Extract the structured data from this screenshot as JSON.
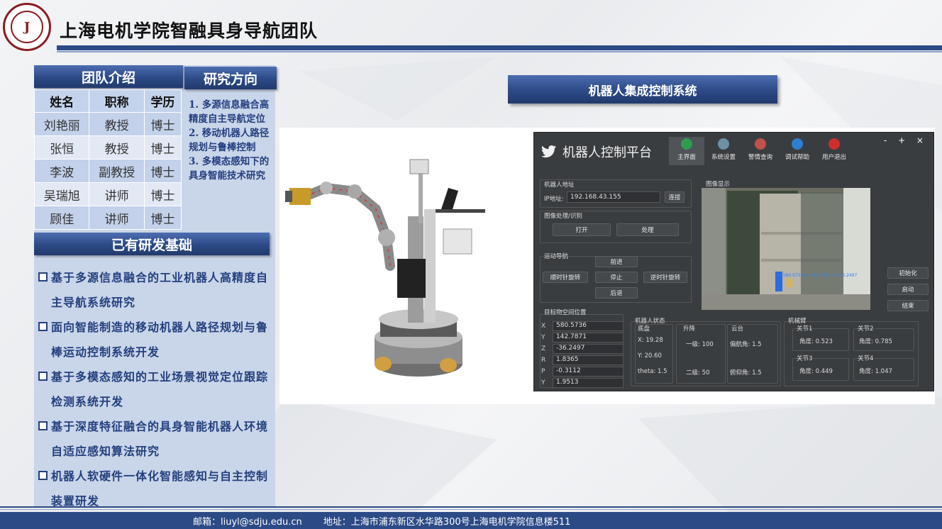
{
  "header": {
    "title": "上海电机学院智融具身导航团队",
    "logo_text": "上海电机学院",
    "logo_ring": "SHANGHAI DIANJI UNIVERSITY"
  },
  "team": {
    "heading": "团队介绍",
    "columns": [
      "姓名",
      "职称",
      "学历"
    ],
    "rows": [
      [
        "刘艳丽",
        "教授",
        "博士"
      ],
      [
        "张恒",
        "教授",
        "博士"
      ],
      [
        "李波",
        "副教授",
        "博士"
      ],
      [
        "吴瑞旭",
        "讲师",
        "博士"
      ],
      [
        "顾佳",
        "讲师",
        "博士"
      ]
    ]
  },
  "research": {
    "heading": "研究方向",
    "items": [
      "1. 多源信息融合高精度自主导航定位",
      "2. 移动机器人路径规划与鲁棒控制",
      "3. 多模态感知下的具身智能技术研究"
    ]
  },
  "foundation": {
    "heading": "已有研发基础",
    "items": [
      "基于多源信息融合的工业机器人高精度自主导航系统研究",
      "面向智能制造的移动机器人路径规划与鲁棒运动控制系统开发",
      "基于多模态感知的工业场景视觉定位跟踪检测系统开发",
      "基于深度特征融合的具身智能机器人环境自适应感知算法研究",
      "机器人软硬件一体化智能感知与自主控制装置研发"
    ]
  },
  "system": {
    "heading": "机器人集成控制系统"
  },
  "platform": {
    "title": "机器人控制平台",
    "window_controls": "- + ×",
    "tabs": [
      {
        "label": "主界面",
        "icon": "shield-icon",
        "color": "#2e9c4a"
      },
      {
        "label": "系统设置",
        "icon": "gear-icon",
        "color": "#6d8fa8"
      },
      {
        "label": "警情查询",
        "icon": "search-icon",
        "color": "#c0504d"
      },
      {
        "label": "调试帮助",
        "icon": "person-icon",
        "color": "#2d7fd0"
      },
      {
        "label": "用户退出",
        "icon": "power-icon",
        "color": "#d02d2d"
      }
    ],
    "robot_addr": {
      "label": "机器人地址",
      "ip_label": "IP地址:",
      "ip_value": "192.168.43.155",
      "connect": "连接"
    },
    "image_proc": {
      "label": "图像处理/识别",
      "open": "打开",
      "process": "处理"
    },
    "motion": {
      "label": "运动导航",
      "forward": "前进",
      "cw": "顺时针旋转",
      "stop": "停止",
      "ccw": "逆时针旋转",
      "back": "后退"
    },
    "image_display": {
      "label": "图像显示",
      "overlay": "x=580.5736,y=142.7871,z=-36.2497"
    },
    "side_buttons": [
      "初始化",
      "启动",
      "结束"
    ],
    "target": {
      "label": "目标物空间位置",
      "rows": [
        {
          "k": "X",
          "v": "580.5736"
        },
        {
          "k": "Y",
          "v": "142.7871"
        },
        {
          "k": "Z",
          "v": "-36.2497"
        },
        {
          "k": "R",
          "v": "1.8365"
        },
        {
          "k": "P",
          "v": "-0.3112"
        },
        {
          "k": "Y",
          "v": "1.9513"
        }
      ]
    },
    "status": {
      "label": "机器人状态",
      "base_label": "底盘",
      "x": "X: 19.28",
      "y": "Y: 20.60",
      "theta": "theta: 1.5",
      "lift_label": "升降",
      "lift1": "一级: 100",
      "lift2": "二级: 50",
      "ptz_label": "云台",
      "yaw": "偏航角: 1.5",
      "pitch": "俯仰角: 1.5"
    },
    "arm": {
      "label": "机械臂",
      "joints": [
        {
          "name": "关节1",
          "value": "角度: 0.523"
        },
        {
          "name": "关节2",
          "value": "角度: 0.785"
        },
        {
          "name": "关节3",
          "value": "角度: 0.449"
        },
        {
          "name": "关节4",
          "value": "角度: 1.047"
        }
      ]
    }
  },
  "footer": {
    "email": "邮箱：liuyl@sdju.edu.cn",
    "address": "地址：上海市浦东新区水华路300号上海电机学院信息楼511"
  },
  "colors": {
    "brand_blue": "#2c4a86",
    "brand_red": "#8a1c22",
    "panel_bg": "#c9d5e9"
  }
}
